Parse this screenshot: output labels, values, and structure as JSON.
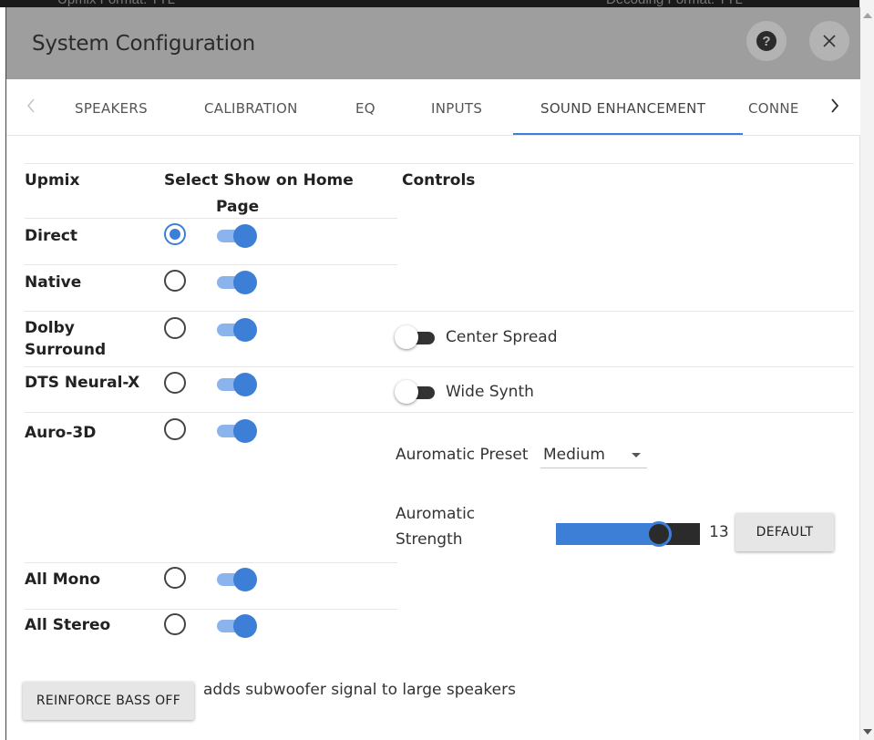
{
  "backdrop": {
    "left_text": "Upmix Format: TTL",
    "right_text": "Decoding Format: TTL"
  },
  "dialog": {
    "title": "System Configuration",
    "help_icon": "help-icon",
    "close_icon": "close-icon",
    "close_glyph": "×",
    "help_glyph": "?"
  },
  "tabs": {
    "prev_glyph": "‹",
    "next_glyph": "›",
    "items": [
      {
        "label": "SPEAKERS",
        "active": false
      },
      {
        "label": "CALIBRATION",
        "active": false
      },
      {
        "label": "EQ",
        "active": false
      },
      {
        "label": "INPUTS",
        "active": false
      },
      {
        "label": "SOUND ENHANCEMENT",
        "active": true
      },
      {
        "label": "CONNE",
        "active": false
      }
    ]
  },
  "table": {
    "headers": {
      "upmix": "Upmix",
      "select": "Select Show on Home",
      "select_line2": "Page",
      "controls": "Controls"
    },
    "rows": [
      {
        "label": "Direct",
        "selected": true,
        "show_on_home": true
      },
      {
        "label": "Native",
        "selected": false,
        "show_on_home": true
      },
      {
        "label": "Dolby",
        "label_line2": "Surround",
        "selected": false,
        "show_on_home": true
      },
      {
        "label": "DTS Neural-X",
        "selected": false,
        "show_on_home": true
      },
      {
        "label": "Auro-3D",
        "selected": false,
        "show_on_home": true
      },
      {
        "label": "All Mono",
        "selected": false,
        "show_on_home": true
      },
      {
        "label": "All Stereo",
        "selected": false,
        "show_on_home": true
      }
    ]
  },
  "controls": {
    "center_spread": {
      "label": "Center Spread",
      "on": false
    },
    "wide_synth": {
      "label": "Wide Synth",
      "on": false
    },
    "auromatic_preset": {
      "label": "Auromatic Preset",
      "value": "Medium"
    },
    "auromatic_strength": {
      "label": "Auromatic",
      "label_line2": "Strength",
      "value": "13",
      "level_fraction": 0.8
    },
    "default_button": "DEFAULT"
  },
  "bass": {
    "button_label": "REINFORCE BASS OFF",
    "description": "adds subwoofer signal to large speakers"
  },
  "colors": {
    "accent": "#3d7fd6",
    "titlebar": "#9e9e9e",
    "switch_track_on": "#8cb4ec"
  }
}
